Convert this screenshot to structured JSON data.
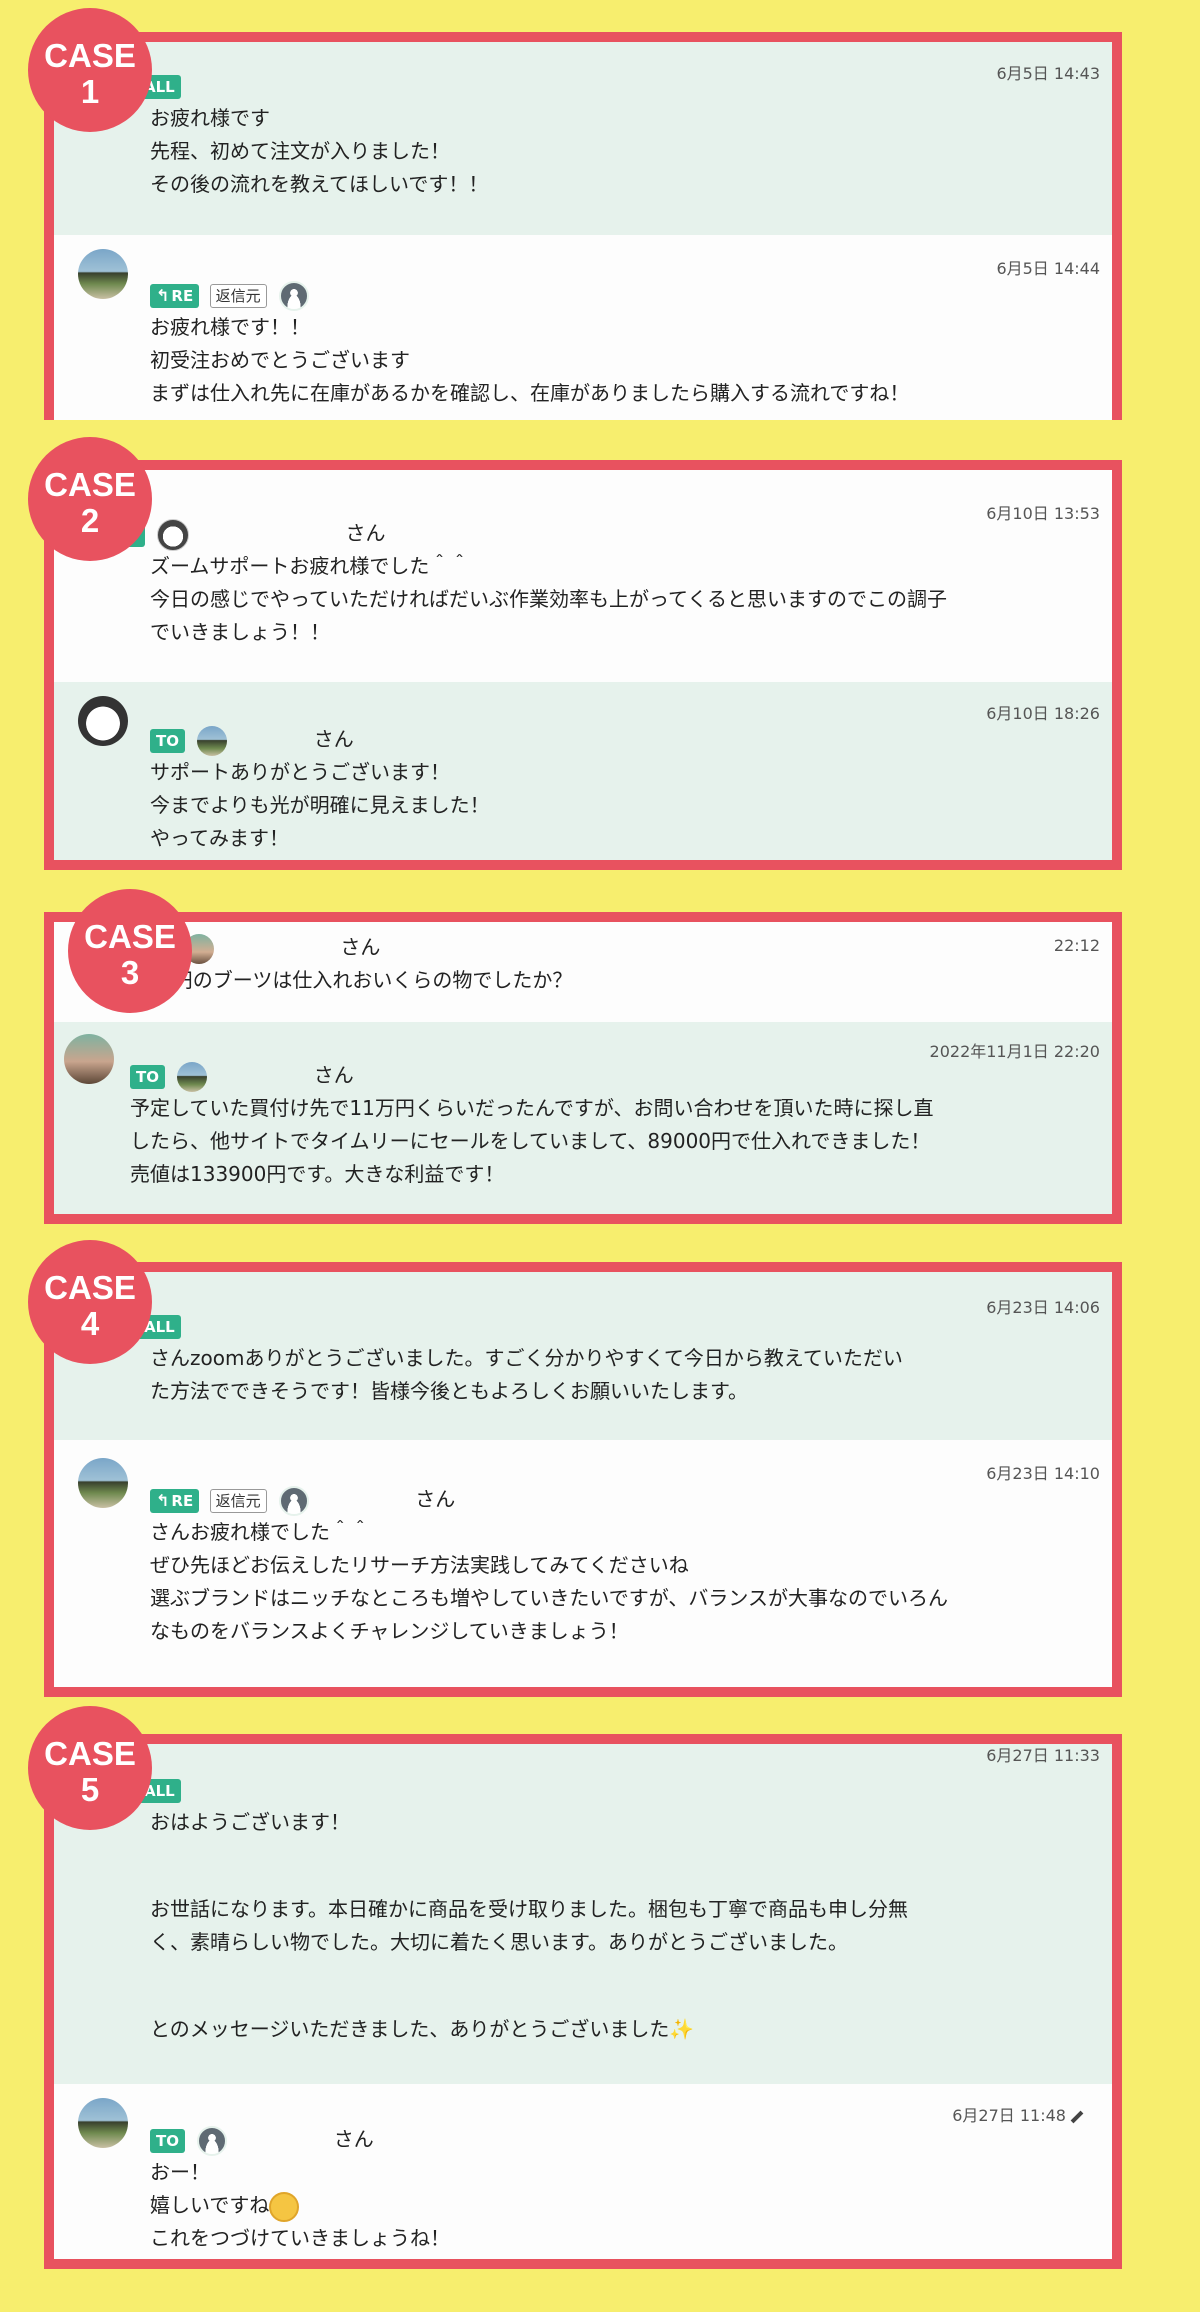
{
  "badges": [
    {
      "word": "CASE",
      "num": "1"
    },
    {
      "word": "CASE",
      "num": "2"
    },
    {
      "word": "CASE",
      "num": "3"
    },
    {
      "word": "CASE",
      "num": "4"
    },
    {
      "word": "CASE",
      "num": "5"
    }
  ],
  "case1": {
    "m1": {
      "time": "6月5日 14:43",
      "tag": "O ALL",
      "lines": "お疲れ様です\n先程、初めて注文が入りました！\nその後の流れを教えてほしいです！！"
    },
    "m2": {
      "time": "6月5日 14:44",
      "tag": "RE",
      "reply": "返信元",
      "lines": "お疲れ様です！！\n初受注おめでとうございます\nまずは仕入れ先に在庫があるかを確認し、在庫がありましたら購入する流れですね！"
    }
  },
  "case2": {
    "m1": {
      "time": "6月10日 13:53",
      "tag": "O",
      "san": "さん",
      "lines": "ズームサポートお疲れ様でした＾＾\n今日の感じでやっていただければだいぶ作業効率も上がってくると思いますのでこの調子\nでいきましょう！！"
    },
    "m2": {
      "time": "6月10日 18:26",
      "tag": "TO",
      "san": "さん",
      "lines": "サポートありがとうございます！\n今までよりも光が明確に見えました！\nやってみます！"
    }
  },
  "case3": {
    "m1": {
      "time": "22:12",
      "san": "さん",
      "lines": "3万円のブーツは仕入れおいくらの物でしたか？"
    },
    "m2": {
      "time": "2022年11月1日 22:20",
      "tag": "TO",
      "san": "さん",
      "lines": "予定していた買付け先で11万円くらいだったんですが、お問い合わせを頂いた時に探し直\nしたら、他サイトでタイムリーにセールをしていまして、89000円で仕入れできました！\n売値は133900円です。大きな利益です！"
    }
  },
  "case4": {
    "m1": {
      "time": "6月23日 14:06",
      "tag": "O ALL",
      "lines": "さんzoomありがとうございました。すごく分かりやすくて今日から教えていただい\nた方法でできそうです！皆様今後ともよろしくお願いいたします。"
    },
    "m2": {
      "time": "6月23日 14:10",
      "tag": "RE",
      "reply": "返信元",
      "san": "さん",
      "lines": "さんお疲れ様でした＾＾\nぜひ先ほどお伝えしたリサーチ方法実践してみてくださいね\n選ぶブランドはニッチなところも増やしていきたいですが、バランスが大事なのでいろん\nなものをバランスよくチャレンジしていきましょう！"
    }
  },
  "case5": {
    "m1": {
      "time": "6月27日 11:33",
      "tag": "O ALL",
      "l1": "おはようございます！",
      "l2": "お世話になります。本日確かに商品を受け取りました。梱包も丁寧で商品も申し分無\nく、素晴らしい物でした。大切に着たく思います。ありがとうございました。",
      "l3": "とのメッセージいただきました、ありがとうございました"
    },
    "m2": {
      "time": "6月27日 11:48",
      "tag": "TO",
      "san": "さん",
      "l1": "おー！",
      "l2": "嬉しいですね",
      "l3": "これをつづけていきましょうね！"
    }
  }
}
